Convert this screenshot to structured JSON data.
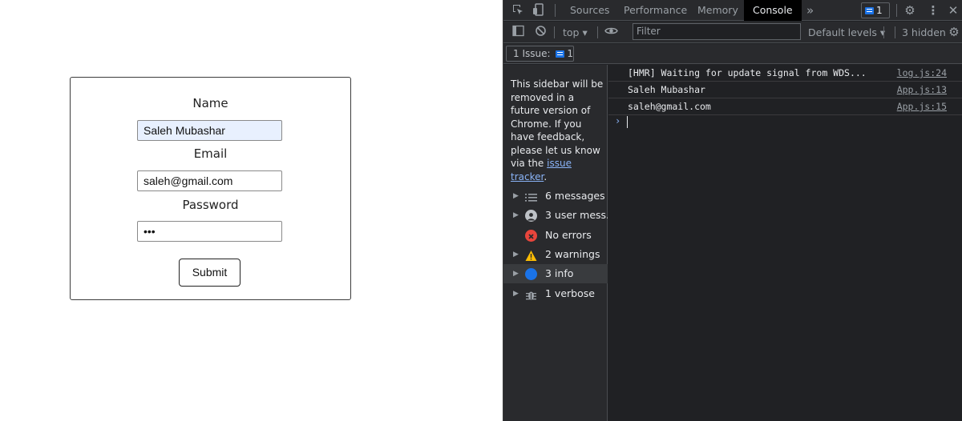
{
  "form": {
    "name_label": "Name",
    "name_value": "Saleh Mubashar",
    "email_label": "Email",
    "email_value": "saleh@gmail.com",
    "password_label": "Password",
    "password_value": "•••",
    "submit_label": "Submit"
  },
  "devtools": {
    "tabs": [
      "Sources",
      "Performance",
      "Memory",
      "Console"
    ],
    "active_tab": "Console",
    "more_tabs": "»",
    "issue_count": "1",
    "toolbar": {
      "context": "top ▾",
      "filter_placeholder": "Filter",
      "levels": "Default levels ▾",
      "hidden": "3 hidden"
    },
    "issues_bar": {
      "label": "1 Issue:",
      "count": "1"
    },
    "sidebar": {
      "note": "This sidebar will be removed in a future version of Chrome. If you have feedback, please let us know via the ",
      "link": "issue tracker",
      "note_end": ".",
      "items": [
        {
          "label": "6 messages",
          "icon": "list-icon"
        },
        {
          "label": "3 user mess...",
          "icon": "user-icon"
        },
        {
          "label": "No errors",
          "icon": "error-icon"
        },
        {
          "label": "2 warnings",
          "icon": "warning-icon"
        },
        {
          "label": "3 info",
          "icon": "info-icon"
        },
        {
          "label": "1 verbose",
          "icon": "bug-icon"
        }
      ]
    },
    "messages": [
      {
        "text": "[HMR] Waiting for update signal from WDS...",
        "source": "log.js:24"
      },
      {
        "text": "Saleh Mubashar",
        "source": "App.js:13"
      },
      {
        "text": "saleh@gmail.com",
        "source": "App.js:15"
      }
    ],
    "prompt": "›"
  },
  "colors": {
    "devtools_bg": "#202124",
    "accent_blue": "#1a73e8",
    "link_blue": "#8ab4f8",
    "error_red": "#e8453c",
    "warning_yellow": "#fbbc04",
    "autofill_bg": "#e8f0fe"
  }
}
